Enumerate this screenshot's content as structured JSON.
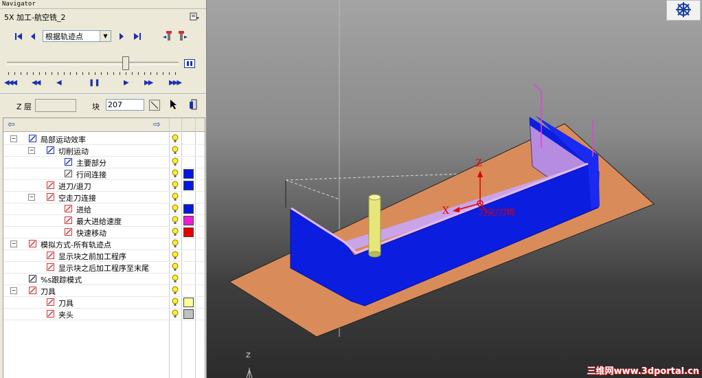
{
  "window": {
    "title": "Navigator"
  },
  "operation": {
    "name": "5X 加工-航空铣_2"
  },
  "controls": {
    "mode_select_value": "根据轨迹点",
    "z_layer_label": "Z 层",
    "z_layer_value": "",
    "block_label": "块",
    "block_value": "207"
  },
  "playback": {
    "buttons": [
      "fast-rewind",
      "rewind",
      "step-back",
      "pause",
      "step-forward",
      "forward",
      "fast-forward"
    ]
  },
  "tree": {
    "items": [
      {
        "label": "局部运动效率",
        "level": 0,
        "expander": "−",
        "icon": "motion-icon",
        "swatch": ""
      },
      {
        "label": "切削运动",
        "level": 1,
        "expander": "−",
        "icon": "box-icon",
        "swatch": ""
      },
      {
        "label": "主要部分",
        "level": 2,
        "expander": "",
        "icon": "box-icon",
        "swatch": ""
      },
      {
        "label": "行间连接",
        "level": 2,
        "expander": "",
        "icon": "link-icon",
        "swatch": "#0018e0"
      },
      {
        "label": "进刀/退刀",
        "level": 1,
        "expander": "",
        "icon": "approach-icon",
        "swatch": "#0018e0"
      },
      {
        "label": "空走刀连接",
        "level": 1,
        "expander": "−",
        "icon": "rapid-link-icon",
        "swatch": ""
      },
      {
        "label": "进给",
        "level": 2,
        "expander": "",
        "icon": "feed-icon",
        "swatch": "#0018e0"
      },
      {
        "label": "最大进给速度",
        "level": 2,
        "expander": "",
        "icon": "feed-icon",
        "swatch": "#f01cd8"
      },
      {
        "label": "快速移动",
        "level": 2,
        "expander": "",
        "icon": "feed-icon",
        "swatch": "#e80000"
      },
      {
        "label": "模拟方式-所有轨迹点",
        "level": 0,
        "expander": "−",
        "icon": "tool-sim-icon",
        "swatch": ""
      },
      {
        "label": "显示块之前加工程序",
        "level": 1,
        "expander": "",
        "icon": "tool-before-icon",
        "swatch": ""
      },
      {
        "label": "显示块之后加工程序至末尾",
        "level": 1,
        "expander": "",
        "icon": "tool-after-icon",
        "swatch": ""
      },
      {
        "label": "%s跟踪模式",
        "level": 0,
        "expander": "",
        "icon": "trace-icon",
        "swatch": ""
      },
      {
        "label": "刀具",
        "level": 0,
        "expander": "−",
        "icon": "tool-icon",
        "swatch": ""
      },
      {
        "label": "刀具",
        "level": 1,
        "expander": "",
        "icon": "tool-icon",
        "swatch": "#ffff99"
      },
      {
        "label": "夹头",
        "level": 1,
        "expander": "",
        "icon": "holder-icon",
        "swatch": "#c0c0c0"
      }
    ]
  },
  "viewport": {
    "axis_z": "Z",
    "axis_x": "X",
    "origin_label": "刀尖/刀柄",
    "bottom_axis": "Z",
    "watermark": "三维网www.3dportal.cn"
  },
  "colors": {
    "toolpath_blue": "#0018e0",
    "stock_orange": "#d98c5a",
    "wall_purple": "#b68ce0",
    "tool_yellow": "#e6e67a",
    "axis_red": "#e00000"
  }
}
